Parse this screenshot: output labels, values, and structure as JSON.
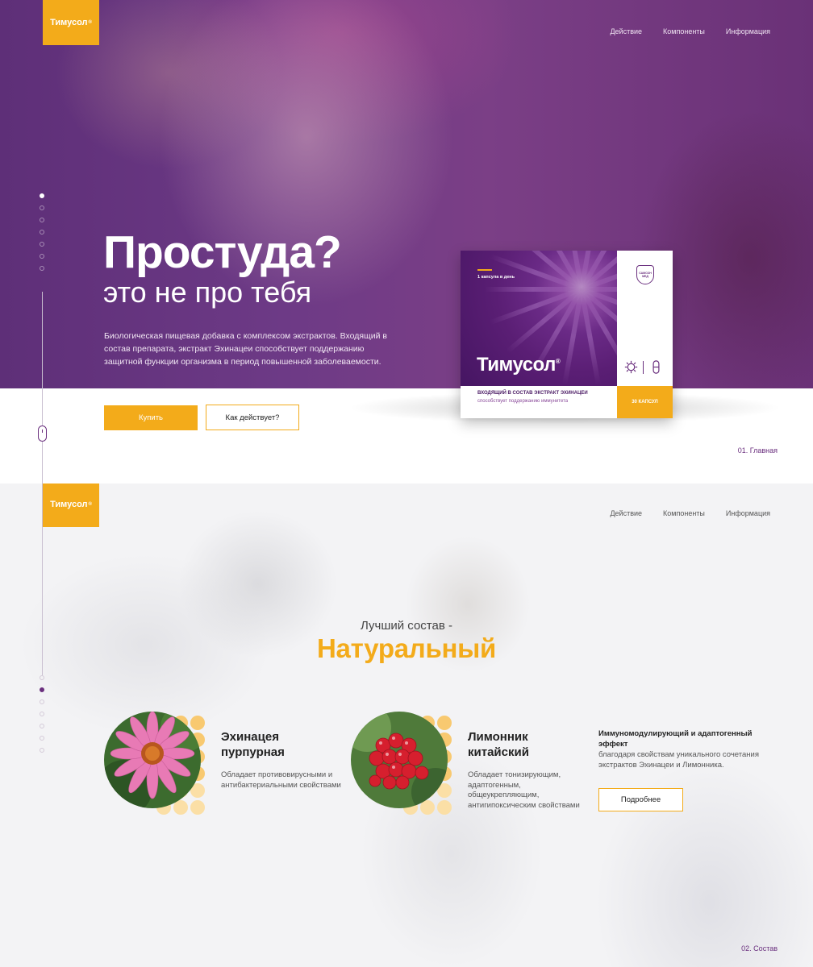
{
  "brand": {
    "name": "Тимусол",
    "mark": "®"
  },
  "nav": {
    "action": "Действие",
    "components": "Компоненты",
    "info": "Информация"
  },
  "hero": {
    "title": "Простуда?",
    "subtitle": "это не про тебя",
    "description": "Биологическая пищевая добавка с комплексом экстрактов. Входящий в состав препарата, экстракт Эхинацеи способствует поддержанию защитной функции организма в период повышенной заболеваемости.",
    "buy_label": "Купить",
    "how_label": "Как действует?",
    "section_label": "01. Главная"
  },
  "product_box": {
    "dose": "1 капсула в день",
    "brand": "Тимусол",
    "line1": "ВХОДЯЩИЙ В СОСТАВ ЭКСТРАКТ ЭХИНАЦЕИ",
    "line2": "способствует поддержанию иммунитета",
    "count": "30 КАПСУЛ",
    "maker_line1": "САМСОН",
    "maker_line2": "МЕД"
  },
  "composition": {
    "subtitle": "Лучший состав -",
    "title": "Натуральный",
    "herbs": [
      {
        "title_l1": "Эхинацея",
        "title_l2": "пурпурная",
        "desc": "Обладает противовирусными и антибактериальными свойствами"
      },
      {
        "title_l1": "Лимонник",
        "title_l2": "китайский",
        "desc": "Обладает тонизирующим, адаптогенным, общеукрепляющим, антигипоксическим свойствами"
      }
    ],
    "effect_title": "Иммуномодулирующий и адаптогенный эффект",
    "effect_desc": "благодаря свойствам уникального сочетания экстрактов Эхинацеи и Лимонника.",
    "more_label": "Подробнее",
    "section_label": "02. Состав"
  },
  "colors": {
    "accent": "#f3ab1a",
    "purple": "#6a2f7e"
  },
  "pagination": {
    "count": 7,
    "active_section1": 1,
    "active_section2": 2
  }
}
